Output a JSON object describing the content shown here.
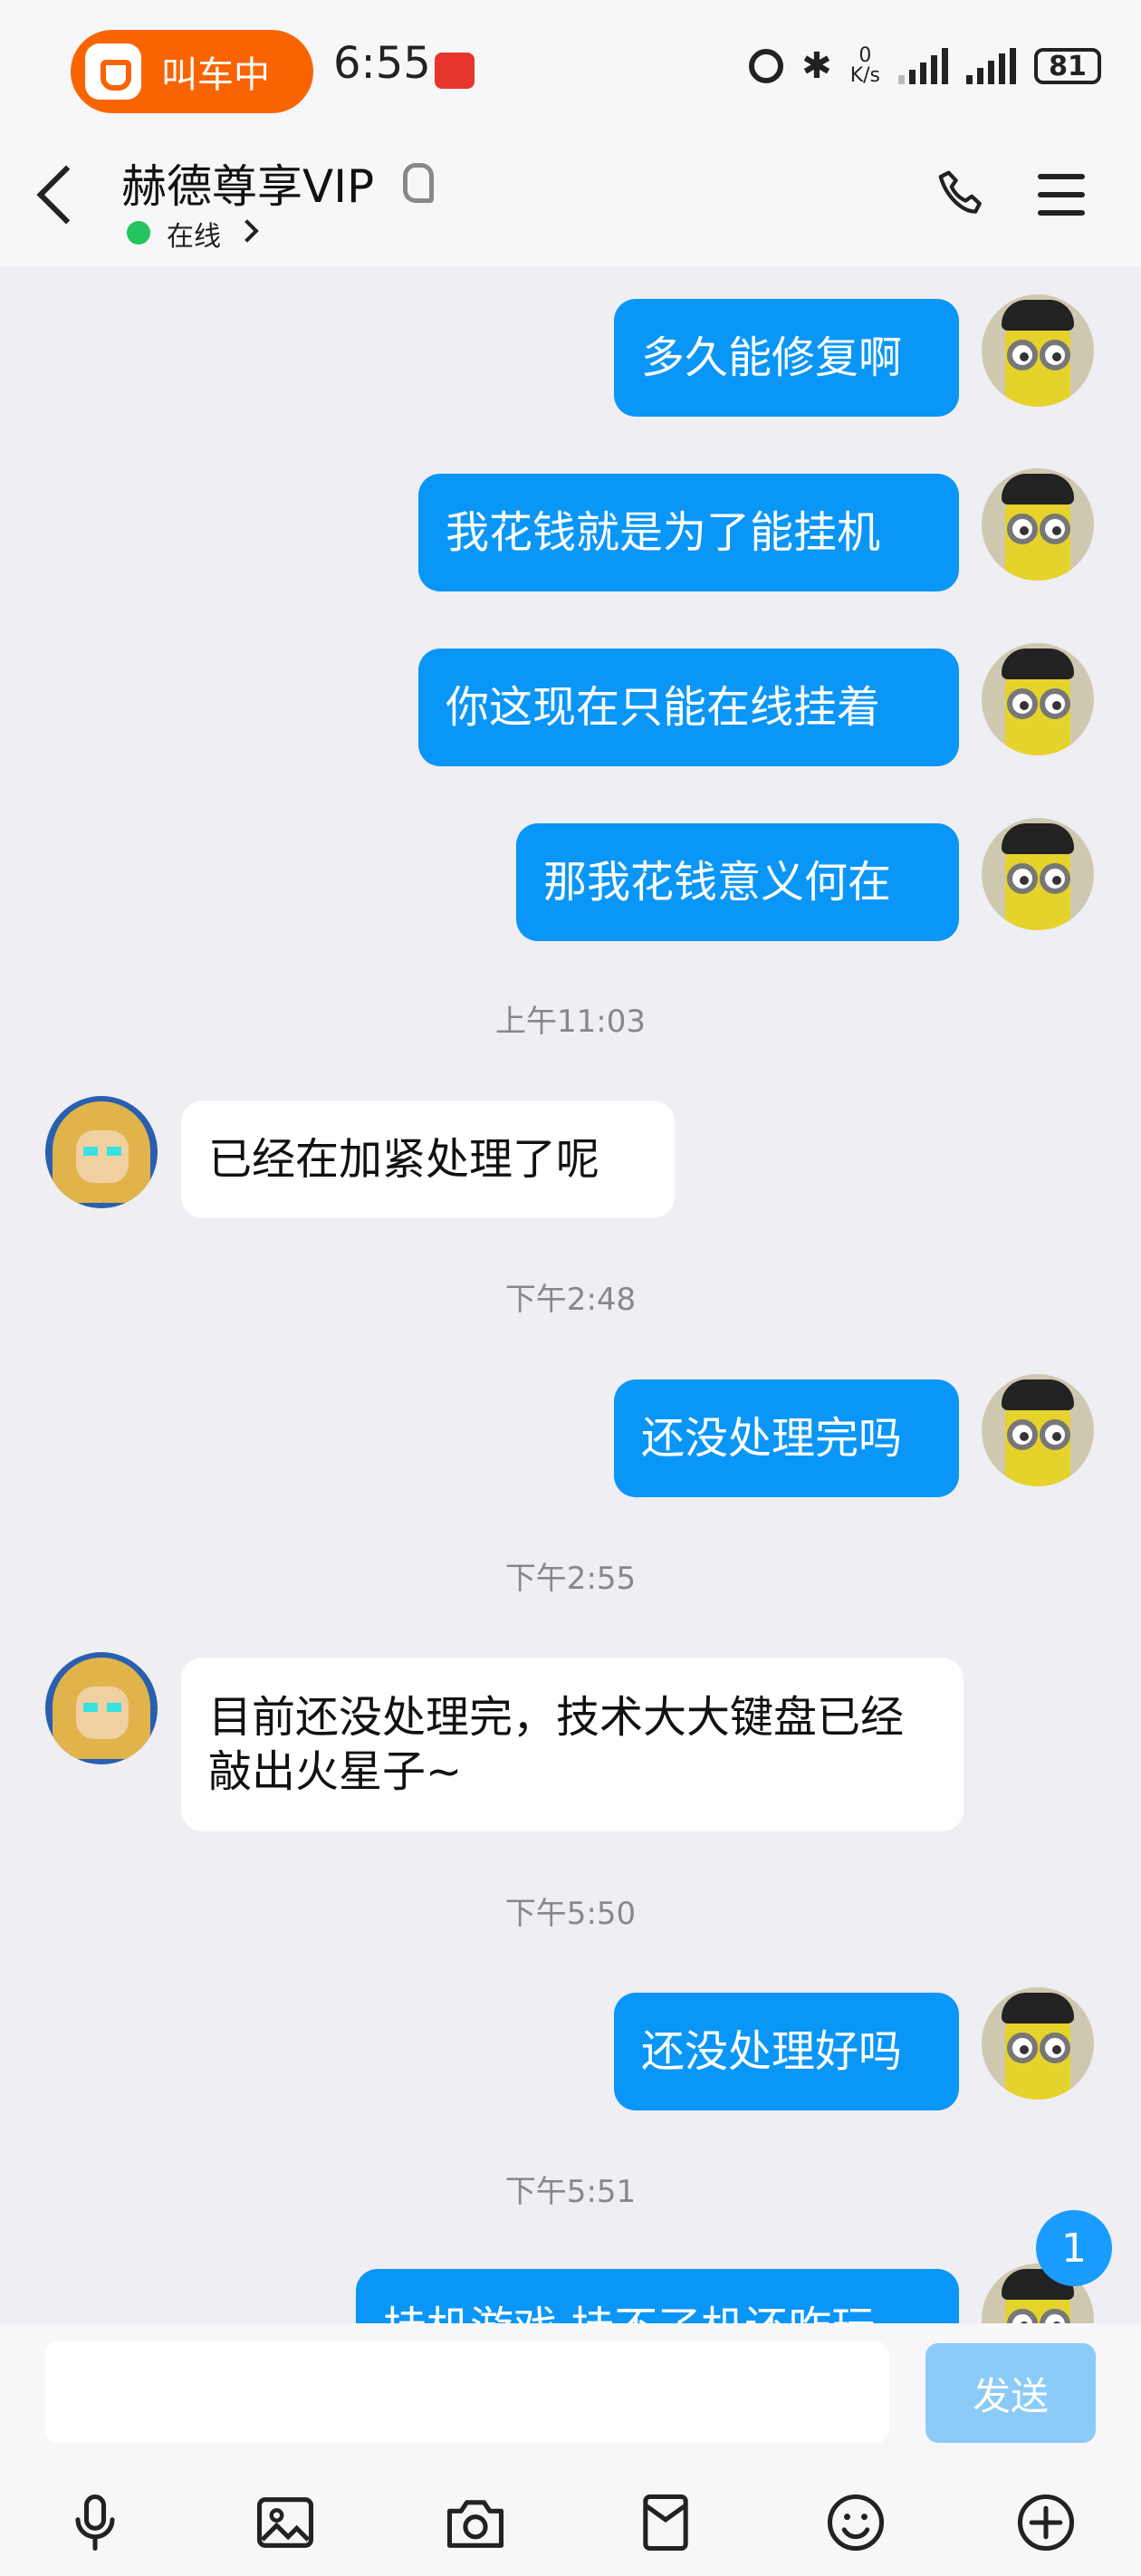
{
  "status_bar": {
    "didi_pill": "叫车中",
    "time": "6:55",
    "net_speed_top": "0",
    "net_speed_unit": "K/s",
    "battery": "81"
  },
  "header": {
    "title": "赫德尊享VIP",
    "status": "在线",
    "online_color": "#22c55e",
    "icons": [
      "back-icon",
      "ear-icon",
      "phone-icon",
      "menu-icon"
    ]
  },
  "messages": [
    {
      "dir": "out",
      "text": "多久能修复啊"
    },
    {
      "dir": "out",
      "text": "我花钱就是为了能挂机"
    },
    {
      "dir": "out",
      "text": "你这现在只能在线挂着"
    },
    {
      "dir": "out",
      "text": "那我花钱意义何在"
    },
    {
      "ts": "上午11:03"
    },
    {
      "dir": "in",
      "text": "已经在加紧处理了呢"
    },
    {
      "ts": "下午2:48"
    },
    {
      "dir": "out",
      "text": "还没处理完吗"
    },
    {
      "ts": "下午2:55"
    },
    {
      "dir": "in",
      "text": "目前还没处理完，技术大大键盘已经敲出火星子~"
    },
    {
      "ts": "下午5:50"
    },
    {
      "dir": "out",
      "text": "还没处理好吗"
    },
    {
      "ts": "下午5:51"
    },
    {
      "dir": "out",
      "text": "挂机游戏 挂不了机还咋玩"
    }
  ],
  "unread_badge": "1",
  "input_bar": {
    "input_value": "",
    "send_label": "发送",
    "send_color": "#8ccbf7",
    "tools": [
      "microphone-icon",
      "image-icon",
      "camera-icon",
      "file-icon",
      "emoji-icon",
      "plus-icon"
    ]
  },
  "colors": {
    "outgoing_bubble": "#0a96f7",
    "incoming_bubble": "#ffffff",
    "background": "#eeeef3"
  }
}
